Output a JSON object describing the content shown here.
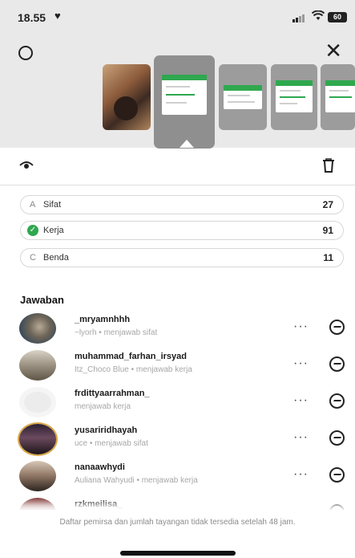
{
  "status_bar": {
    "time": "18.55",
    "battery": "60",
    "icons": [
      "heart-icon",
      "signal-icon",
      "wifi-icon",
      "battery-icon"
    ]
  },
  "header": {
    "icons": [
      "settings-icon",
      "close-icon"
    ],
    "close_glyph": "✕"
  },
  "story_strip": {
    "thumbnails": [
      "photo",
      "poll-selected",
      "poll",
      "poll",
      "poll"
    ]
  },
  "actions": {
    "icons": [
      "eye-icon",
      "trash-icon"
    ]
  },
  "poll": {
    "options": [
      {
        "letter": "A",
        "label": "Sifat",
        "count": "27",
        "selected": false
      },
      {
        "letter": "",
        "label": "Kerja",
        "count": "91",
        "selected": true
      },
      {
        "letter": "C",
        "label": "Benda",
        "count": "11",
        "selected": false
      }
    ],
    "accent_color": "#2fa84f"
  },
  "answers": {
    "title": "Jawaban",
    "items": [
      {
        "username": "_mryamnhhh",
        "subtitle": "~lyorh • menjawab sifat"
      },
      {
        "username": "muhammad_farhan_irsyad",
        "subtitle": "Itz_Choco Blue • menjawab kerja"
      },
      {
        "username": "frdittyaarrahman_",
        "subtitle": "menjawab kerja"
      },
      {
        "username": "yusariridhayah",
        "subtitle": "uce • menjawab sifat"
      },
      {
        "username": "nanaawhydi",
        "subtitle": "Auliana Wahyudi • menjawab kerja"
      },
      {
        "username": "rzkmeilisa_",
        "subtitle": ""
      }
    ]
  },
  "footer": {
    "note": "Daftar pemirsa dan jumlah tayangan tidak tersedia setelah 48 jam."
  }
}
